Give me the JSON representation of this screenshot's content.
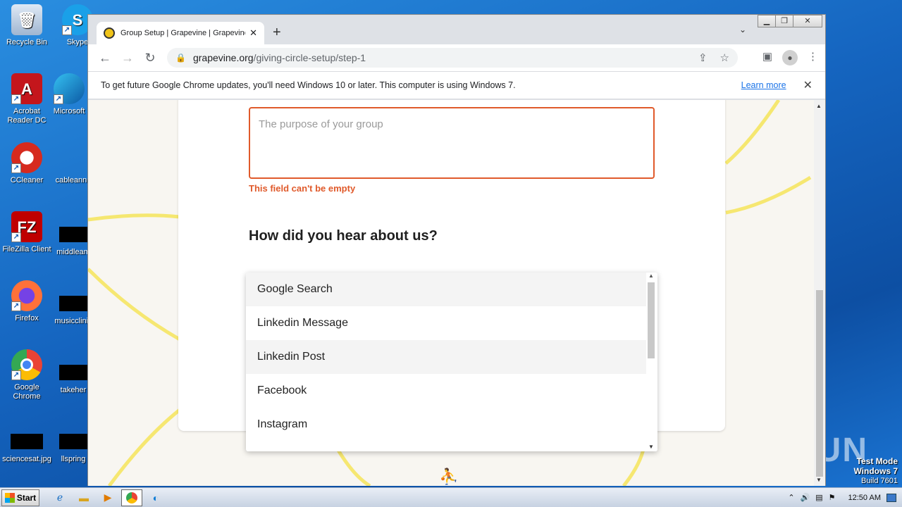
{
  "desktop": {
    "icons": [
      {
        "label": "Recycle Bin",
        "icon": "recycle-bin-icon"
      },
      {
        "label": "Skype",
        "icon": "skype-icon"
      },
      {
        "label": "Acrobat Reader DC",
        "icon": "acrobat-icon"
      },
      {
        "label": "Microsoft",
        "icon": "edge-icon"
      },
      {
        "label": "CCleaner",
        "icon": "ccleaner-icon"
      },
      {
        "label": "cableannu",
        "icon": "file-icon"
      },
      {
        "label": "FileZilla Client",
        "icon": "filezilla-icon"
      },
      {
        "label": "middleam",
        "icon": "file-icon"
      },
      {
        "label": "Firefox",
        "icon": "firefox-icon"
      },
      {
        "label": "musicclinic",
        "icon": "file-icon"
      },
      {
        "label": "Google Chrome",
        "icon": "chrome-icon"
      },
      {
        "label": "takeher",
        "icon": "file-icon"
      },
      {
        "label": "sciencesat.jpg",
        "icon": "image-file-icon"
      },
      {
        "label": "llspring",
        "icon": "file-icon"
      }
    ],
    "watermark": "ANY RUN",
    "test_mode": {
      "line1": "Test Mode",
      "line2": "Windows 7",
      "line3": "Build 7601"
    }
  },
  "browser": {
    "tab_title": "Group Setup | Grapevine | Grapevine",
    "url_host": "grapevine.org",
    "url_path": "/giving-circle-setup/step-1",
    "infobar_text": "To get future Google Chrome updates, you'll need Windows 10 or later. This computer is using Windows 7.",
    "infobar_link": "Learn more"
  },
  "form": {
    "purpose_placeholder": "The purpose of your group",
    "error_text": "This field can't be empty",
    "question": "How did you hear about us?",
    "options": [
      "Google Search",
      "Linkedin Message",
      "Linkedin Post",
      "Facebook",
      "Instagram"
    ],
    "highlighted": [
      0,
      2
    ]
  },
  "taskbar": {
    "start_label": "Start",
    "clock": "12:50 AM"
  }
}
